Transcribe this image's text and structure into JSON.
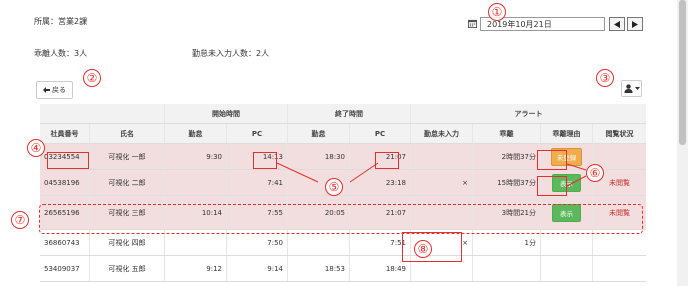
{
  "header": {
    "department": "所属：営業2課",
    "date_value": "2019年10月21日",
    "deviation_count": "乖離人数：3人",
    "unentered_count": "勤怠未入力人数：2人",
    "back_label": "戻る"
  },
  "callouts": [
    "①",
    "②",
    "③",
    "④",
    "⑤",
    "⑥",
    "⑦",
    "⑧"
  ],
  "table": {
    "group_headers": {
      "start": "開始時間",
      "end": "終了時間",
      "alert": "アラート"
    },
    "columns": [
      "社員番号",
      "氏名",
      "勤怠",
      "PC",
      "勤怠",
      "PC",
      "勤怠未入力",
      "乖離",
      "乖離理由",
      "閲覧状況"
    ],
    "rows": [
      {
        "id": "03234554",
        "name": "可視化 一郎",
        "start_att": "9:30",
        "start_pc": "14:13",
        "end_att": "18:30",
        "end_pc": "21:07",
        "missing": "",
        "deviation": "2時間37分",
        "reason": "未登録",
        "status": ""
      },
      {
        "id": "04538196",
        "name": "可視化 二郎",
        "start_att": "",
        "start_pc": "7:41",
        "end_att": "",
        "end_pc": "23:18",
        "missing": "×",
        "deviation": "15時間37分",
        "reason": "表示",
        "status": "未閲覧"
      },
      {
        "id": "26565196",
        "name": "可視化 三郎",
        "start_att": "10:14",
        "start_pc": "7:55",
        "end_att": "20:05",
        "end_pc": "21:07",
        "missing": "",
        "deviation": "3時間21分",
        "reason": "表示",
        "status": "未閲覧"
      },
      {
        "id": "36860743",
        "name": "可視化 四郎",
        "start_att": "",
        "start_pc": "7:50",
        "end_att": "",
        "end_pc": "7:51",
        "missing": "×",
        "deviation": "1分",
        "reason": "",
        "status": ""
      },
      {
        "id": "53409037",
        "name": "可視化 五郎",
        "start_att": "9:12",
        "start_pc": "9:14",
        "end_att": "18:53",
        "end_pc": "18:49",
        "missing": "",
        "deviation": "",
        "reason": "",
        "status": ""
      }
    ]
  },
  "colors": {
    "accent_red": "#e62e2e",
    "warn": "#f0ad4e",
    "ok": "#5cb85c",
    "row_pink": "#f2dede"
  },
  "icons": [
    "calendar-icon",
    "triangle-left-icon",
    "triangle-right-icon",
    "arrow-left-icon",
    "user-icon",
    "caret-down-icon"
  ]
}
